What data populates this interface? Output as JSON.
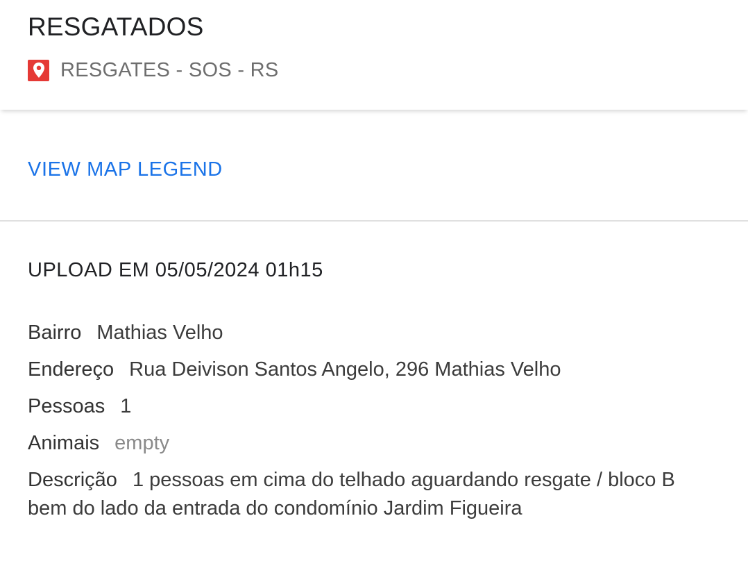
{
  "header": {
    "title": "RESGATADOS",
    "subtitle": "RESGATES - SOS - RS",
    "pin_icon": "map-pin-icon",
    "pin_color": "#e53935"
  },
  "legend": {
    "link_label": "VIEW MAP LEGEND",
    "link_color": "#1a73e8"
  },
  "details": {
    "upload": "UPLOAD EM 05/05/2024 01h15",
    "fields": [
      {
        "label": "Bairro",
        "value": "Mathias Velho"
      },
      {
        "label": "Endereço",
        "value": "Rua Deivison Santos Angelo, 296 Mathias Velho"
      },
      {
        "label": "Pessoas",
        "value": "1"
      },
      {
        "label": "Animais",
        "value": "empty"
      },
      {
        "label": "Descrição",
        "value": "1 pessoas em cima do telhado aguardando resgate / bloco B bem do lado da entrada do condomínio Jardim Figueira"
      }
    ]
  }
}
